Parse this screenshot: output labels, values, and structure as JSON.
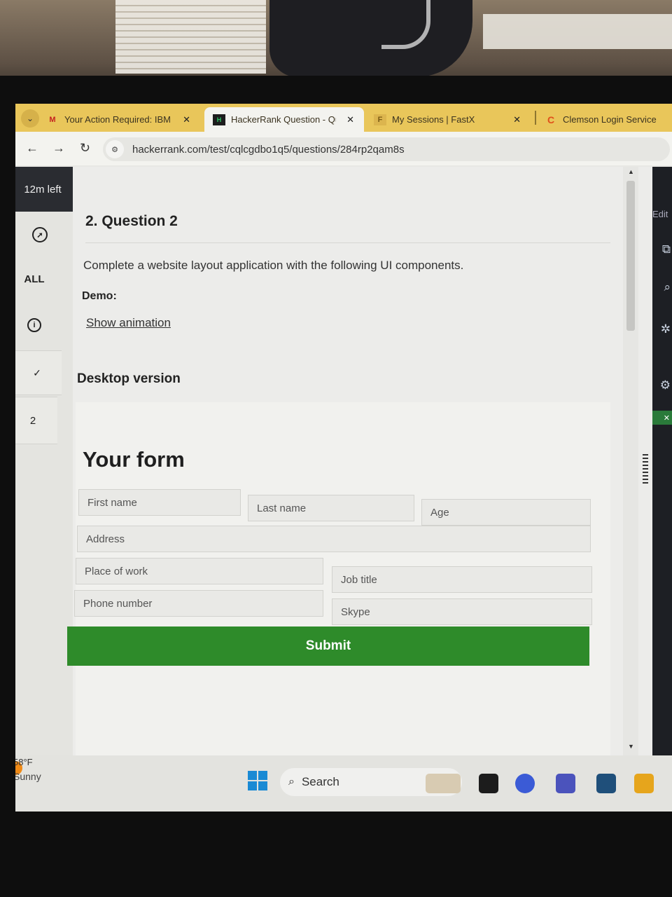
{
  "browser": {
    "tabs": [
      {
        "favicon": "M",
        "title": "Your Action Required: IBM",
        "close": "✕",
        "active": false
      },
      {
        "favicon": "H",
        "title": "HackerRank Question - Qu",
        "close": "✕",
        "active": true
      },
      {
        "favicon": "F",
        "title": "My Sessions | FastX",
        "close": "✕",
        "active": false
      },
      {
        "favicon": "C",
        "title": "Clemson Login Service",
        "close": "",
        "active": false
      }
    ],
    "url": "hackerrank.com/test/cqlcgdbo1q5/questions/284rp2qam8s"
  },
  "sidebar": {
    "timer": "12m left",
    "all_label": "ALL",
    "question_number": "2"
  },
  "question": {
    "title": "2. Question 2",
    "description": "Complete a website layout application with the following UI components.",
    "demo_label": "Demo:",
    "demo_link": "Show animation",
    "section_heading": "Desktop version"
  },
  "form": {
    "title": "Your form",
    "fields": {
      "first_name": "First name",
      "last_name": "Last name",
      "age": "Age",
      "address": "Address",
      "place_of_work": "Place of work",
      "job_title": "Job title",
      "phone_number": "Phone number",
      "skype": "Skype"
    },
    "submit_label": "Submit"
  },
  "editor_panel": {
    "edit_label": "Edit"
  },
  "taskbar": {
    "temperature": "58°F",
    "condition": "Sunny",
    "search_label": "Search"
  },
  "colors": {
    "submit_green": "#2e8b2a",
    "tab_strip": "#e9c65a",
    "timer_bg": "#2a2c31"
  }
}
